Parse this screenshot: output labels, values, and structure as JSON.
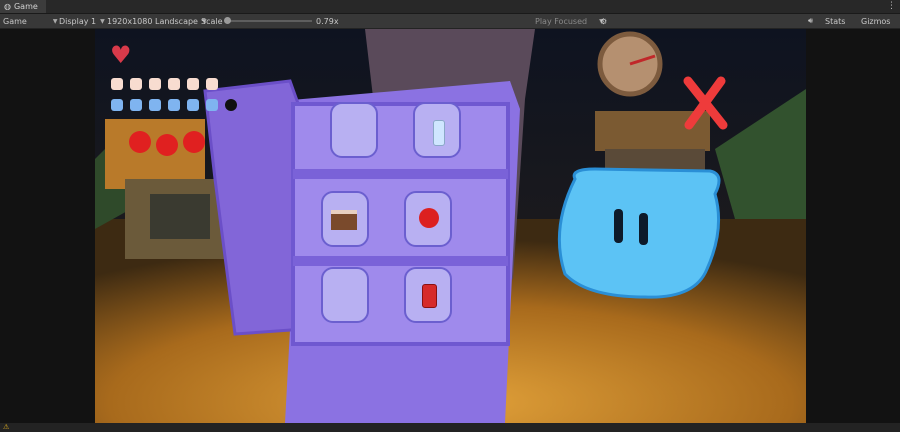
{
  "tab": {
    "title": "Game"
  },
  "toolbar": {
    "mode": "Game",
    "display": "Display 1",
    "resolution": "1920x1080 Landscape",
    "scale_label": "Scale",
    "scale_value": "0.79x",
    "scale_level": 0.79,
    "play_mode": "Play Focused",
    "stats": "Stats",
    "gizmos": "Gizmos"
  },
  "hud": {
    "hunger_filled": 6,
    "thirst_filled": 6,
    "thirst_total": 7,
    "colors": {
      "heart": "#d83a4a",
      "hunger": "#f8dcd0",
      "thirst": "#7fb4f0",
      "empty": "#111111"
    }
  },
  "fridge": {
    "shelves": [
      {
        "left_item": "",
        "right_item": "water-bottle"
      },
      {
        "left_item": "cake-slice",
        "right_item": "apple"
      },
      {
        "left_item": "",
        "right_item": "soda-can"
      }
    ],
    "colors": {
      "body": "#8a6fe0",
      "slot": "#b8b0f2"
    }
  },
  "slime": {
    "color": "#5cc3f5"
  },
  "icons": {
    "close": "red-x-icon",
    "clock": "clock-icon"
  }
}
